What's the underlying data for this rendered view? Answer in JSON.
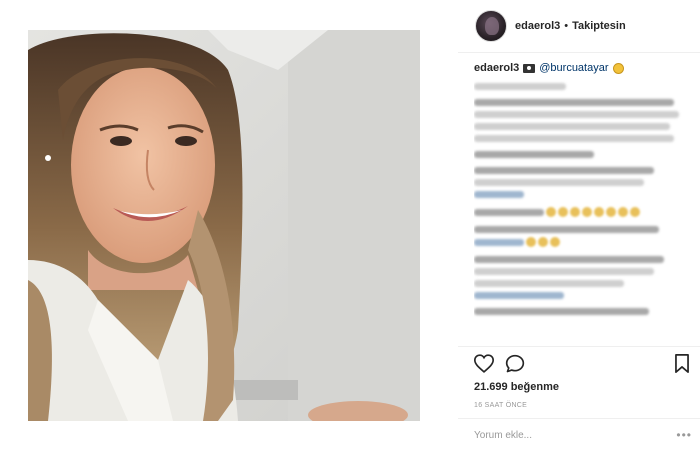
{
  "post": {
    "photo_alt": "",
    "likes_text": "21.699 beğenme",
    "time_ago": "16 SAAT ÖNCE"
  },
  "header": {
    "username": "edaerol3",
    "separator": "•",
    "follow_state": "Takiptesin"
  },
  "caption": {
    "username": "edaerol3",
    "mention": "@burcuatayar"
  },
  "comment_input": {
    "placeholder": "Yorum ekle..."
  },
  "icons": {
    "like": "heart-icon",
    "comment": "comment-icon",
    "save": "bookmark-icon",
    "more": "ellipsis-icon",
    "camera": "camera-icon",
    "emoji": "smile-emoji-icon"
  },
  "colors": {
    "text": "#262626",
    "mention": "#003569",
    "muted": "#999999",
    "divider": "#efefef"
  }
}
